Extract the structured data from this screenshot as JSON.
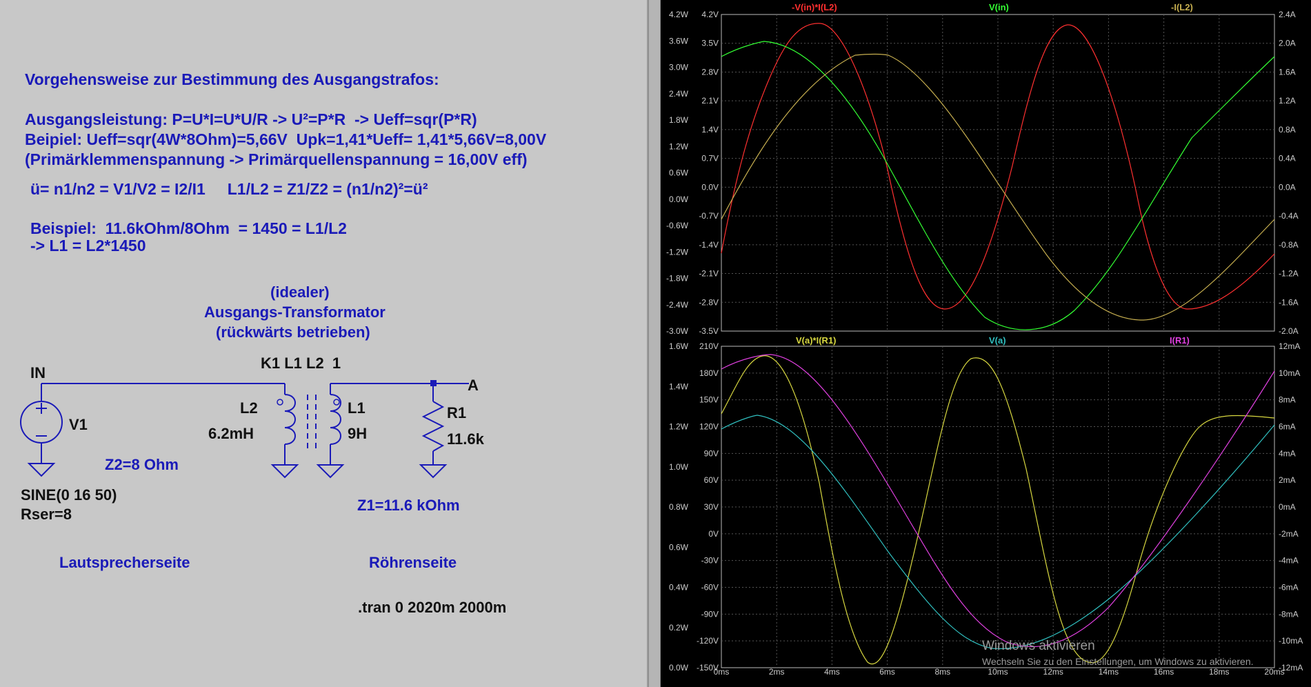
{
  "schematic": {
    "notes": {
      "heading": "Vorgehensweise zur Bestimmung des Ausgangstrafos:",
      "line1": "Ausgangsleistung: P=U*I=U*U/R -> U²=P*R  -> Ueff=sqr(P*R)",
      "line2": "Beipiel: Ueff=sqr(4W*8Ohm)=5,66V  Upk=1,41*Ueff= 1,41*5,66V=8,00V",
      "line3": "(Primärklemmenspannung -> Primärquellenspannung = 16,00V eff)",
      "line4": "ü= n1/n2 = V1/V2 = I2/I1     L1/L2 = Z1/Z2 = (n1/n2)²=ü²",
      "line5": "Beispiel:  11.6kOhm/8Ohm  = 1450 = L1/L2",
      "line6": "-> L1 = L2*1450"
    },
    "transformer_title": {
      "line1": "(idealer)",
      "line2": "Ausgangs-Transformator",
      "line3": "(rückwärts betrieben)"
    },
    "coupling": "K1 L1 L2  1",
    "net_in": "IN",
    "net_a": "A",
    "v1": {
      "name": "V1",
      "value1": "SINE(0 16 50)",
      "value2": "Rser=8"
    },
    "l2": {
      "name": "L2",
      "value": "6.2mH"
    },
    "l1": {
      "name": "L1",
      "value": "9H"
    },
    "r1": {
      "name": "R1",
      "value": "11.6k"
    },
    "z2": "Z2=8 Ohm",
    "z1": "Z1=11.6 kOhm",
    "side_left": "Lautsprecherseite",
    "side_right": "Röhrenseite",
    "directive": ".tran 0 2020m 2000m"
  },
  "plot_top": {
    "traces": [
      {
        "label": "-V(in)*I(L2)",
        "color": "#ff3030"
      },
      {
        "label": "V(in)",
        "color": "#33ff33"
      },
      {
        "label": "-I(L2)",
        "color": "#c8b050"
      }
    ],
    "left_axis_w": [
      "4.2W",
      "3.6W",
      "3.0W",
      "2.4W",
      "1.8W",
      "1.2W",
      "0.6W",
      "0.0W",
      "-0.6W",
      "-1.2W",
      "-1.8W",
      "-2.4W",
      "-3.0W"
    ],
    "left_axis_v": [
      "4.2V",
      "3.5V",
      "2.8V",
      "2.1V",
      "1.4V",
      "0.7V",
      "0.0V",
      "-0.7V",
      "-1.4V",
      "-2.1V",
      "-2.8V",
      "-3.5V"
    ],
    "right_axis": [
      "2.4A",
      "2.0A",
      "1.6A",
      "1.2A",
      "0.8A",
      "0.4A",
      "0.0A",
      "-0.4A",
      "-0.8A",
      "-1.2A",
      "-1.6A",
      "-2.0A"
    ]
  },
  "plot_bottom": {
    "traces": [
      {
        "label": "V(a)*I(R1)",
        "color": "#d8d840"
      },
      {
        "label": "V(a)",
        "color": "#30c0c0"
      },
      {
        "label": "I(R1)",
        "color": "#e040e0"
      }
    ],
    "left_axis_w": [
      "1.6W",
      "1.4W",
      "1.2W",
      "1.0W",
      "0.8W",
      "0.6W",
      "0.4W",
      "0.2W",
      "0.0W"
    ],
    "left_axis_v": [
      "210V",
      "180V",
      "150V",
      "120V",
      "90V",
      "60V",
      "30V",
      "0V",
      "-30V",
      "-60V",
      "-90V",
      "-120V",
      "-150V"
    ],
    "right_axis": [
      "12mA",
      "10mA",
      "8mA",
      "6mA",
      "4mA",
      "2mA",
      "0mA",
      "-2mA",
      "-4mA",
      "-6mA",
      "-8mA",
      "-10mA",
      "-12mA"
    ]
  },
  "x_axis": [
    "0ms",
    "2ms",
    "4ms",
    "6ms",
    "8ms",
    "10ms",
    "12ms",
    "14ms",
    "16ms",
    "18ms",
    "20ms"
  ],
  "watermark": {
    "title": "Windows aktivieren",
    "subtitle": "Wechseln Sie zu den Einstellungen, um Windows zu aktivieren."
  }
}
